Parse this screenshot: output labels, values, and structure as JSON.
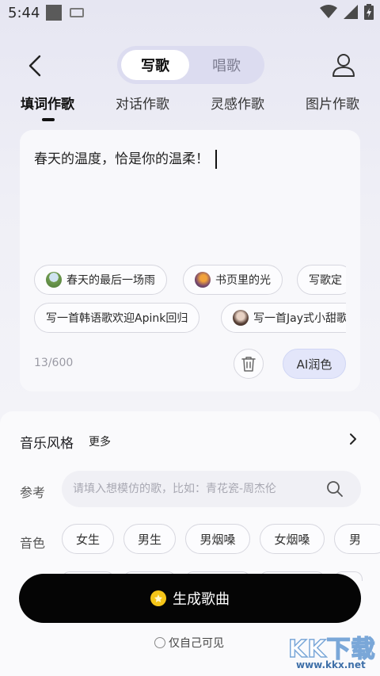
{
  "status_bar": {
    "time": "5:44"
  },
  "header": {
    "segments": [
      {
        "label": "写歌",
        "active": true
      },
      {
        "label": "唱歌",
        "active": false
      }
    ]
  },
  "tabs": [
    {
      "label": "填词作歌",
      "active": true
    },
    {
      "label": "对话作歌",
      "active": false
    },
    {
      "label": "灵感作歌",
      "active": false
    },
    {
      "label": "图片作歌",
      "active": false
    }
  ],
  "editor": {
    "text": "春天的温度，恰是你的温柔！",
    "counter": "13/600",
    "ai_button": "AI润色"
  },
  "suggestions": [
    {
      "label": "春天的最后一场雨",
      "icon": "landscape-thumb"
    },
    {
      "label": "书页里的光",
      "icon": "sunset-thumb"
    },
    {
      "label": "写歌定",
      "icon": ""
    },
    {
      "label": "写一首韩语歌欢迎Apink回归",
      "icon": ""
    },
    {
      "label": "写一首Jay式小甜歌",
      "icon": "avatar-thumb"
    }
  ],
  "style_section": {
    "title": "音乐风格",
    "more": "更多"
  },
  "reference": {
    "label": "参考",
    "placeholder": "请填入想模仿的歌，比如：青花瓷-周杰伦"
  },
  "voice": {
    "label": "音色",
    "options": [
      "女生",
      "男生",
      "男烟嗓",
      "女烟嗓",
      "男"
    ]
  },
  "generate_button": {
    "label": "生成歌曲"
  },
  "privacy": {
    "label": "仅自己可见"
  },
  "watermark": {
    "text": "KK下载",
    "url": "www.kkx.net"
  },
  "colors": {
    "accent": "#050505",
    "segment_bg": "#dcdcf0",
    "ai_button_bg": "#e3e6fa",
    "coin": "#f5c518"
  }
}
